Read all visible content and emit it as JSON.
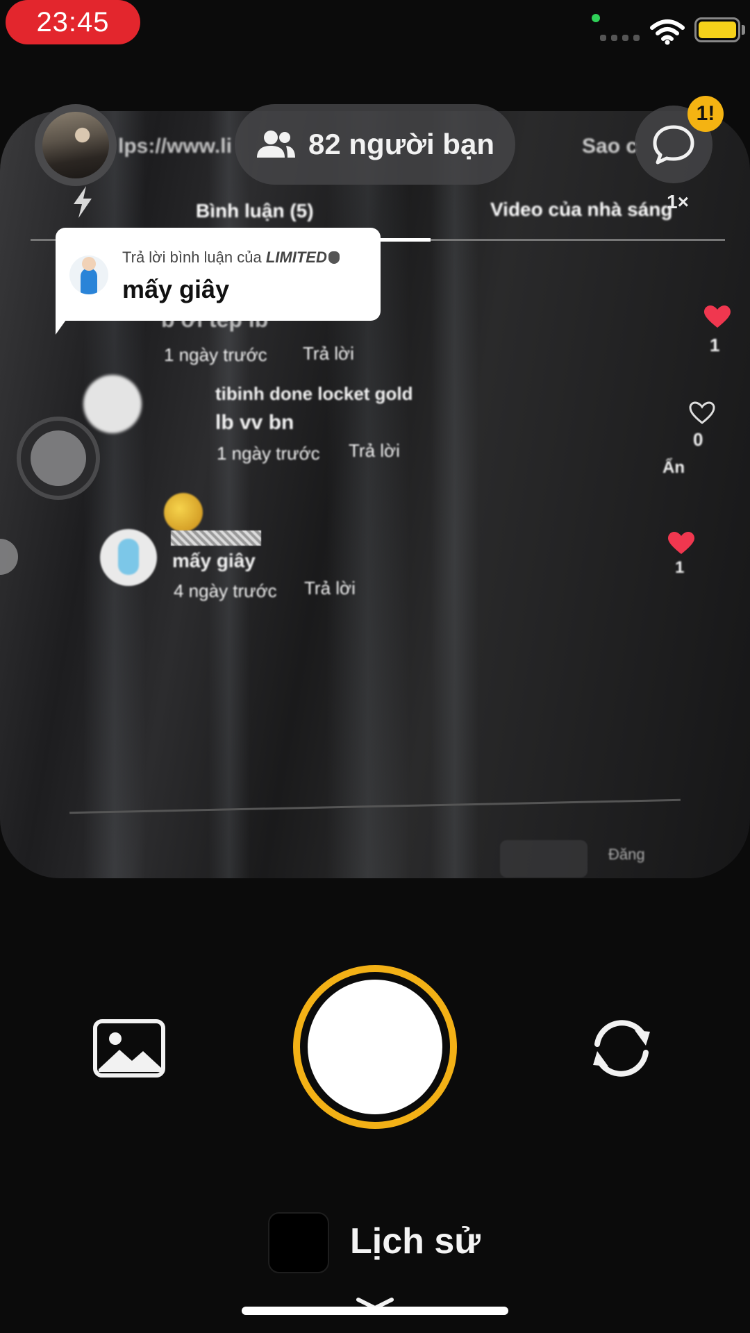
{
  "status_bar": {
    "time": "23:45",
    "battery_color": "#f6d21a",
    "recording_color": "#e3262d"
  },
  "top_bar": {
    "friends_label": "82 người bạn",
    "chat_badge": "1!",
    "zoom_label": "1×",
    "accent_color": "#f3b116"
  },
  "reply_card": {
    "label_prefix": "Trả lời bình luận của ",
    "label_user": "LIMITED",
    "label_suffix": "",
    "text": "mấy giây"
  },
  "preview": {
    "url_text": "lps://www.li",
    "sao_text": "Sao c",
    "tab_comments": "Bình luận (5)",
    "tab_videos": "Video của nhà sáng",
    "comment1_text": "b ơi tép lb",
    "comment1_time": "1 ngày trước",
    "comment1_reply": "Trả lời",
    "comment1_likes": "1",
    "comment2_user": "tibinh done locket gold",
    "comment2_text": "lb vv bn",
    "comment2_time": "1 ngày trước",
    "comment2_reply": "Trả lời",
    "comment2_likes": "0",
    "hide_label": "Ẩn",
    "comment3_text": "mấy giây",
    "comment3_time": "4 ngày trước",
    "comment3_reply": "Trả lời",
    "comment3_likes": "1",
    "post_label": "Đăng"
  },
  "bottom": {
    "history_label": "Lịch sử"
  },
  "icons": [
    "friends-icon",
    "chat-bubble-icon",
    "flash-icon",
    "gallery-icon",
    "flip-camera-icon",
    "chevron-down-icon",
    "heart-icon",
    "wifi-icon",
    "battery-icon"
  ]
}
